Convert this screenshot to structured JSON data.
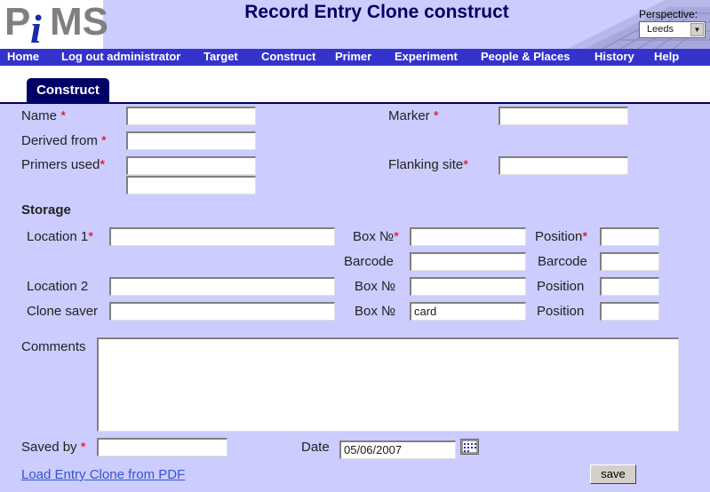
{
  "header": {
    "logo_p": "P",
    "logo_i": "i",
    "logo_ms": "MS",
    "title": "Record Entry Clone construct",
    "perspective_label": "Perspective:",
    "perspective_value": "Leeds"
  },
  "nav": [
    "Home",
    "Log out administrator",
    "Target",
    "Construct",
    "Primer",
    "Experiment",
    "People & Places",
    "History",
    "Help"
  ],
  "tab": "Construct",
  "form": {
    "name_label": "Name",
    "marker_label": "Marker",
    "derived_label": "Derived from",
    "primers_label": "Primers used",
    "flanking_label": "Flanking site",
    "required_mark": "*",
    "storage_heading": "Storage",
    "location1_label": "Location 1",
    "location2_label": "Location 2",
    "clone_saver_label": "Clone saver",
    "box_label": "Box №",
    "barcode_label": "Barcode",
    "position_label": "Position",
    "clone_saver_box_value": "card",
    "comments_label": "Comments",
    "saved_by_label": "Saved by",
    "date_label": "Date",
    "date_value": "05/06/2007"
  },
  "footer": {
    "load_link": "Load Entry Clone from PDF",
    "save_label": "save"
  }
}
